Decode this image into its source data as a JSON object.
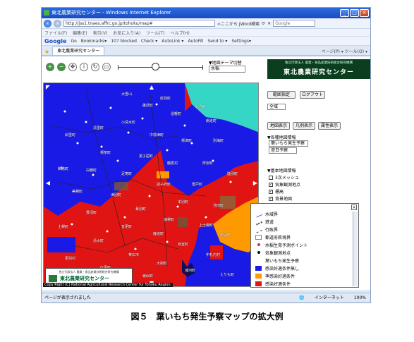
{
  "browser": {
    "title": "東北農業研究センター - Windows Internet Explorer",
    "address": "http://jss1.tnaes.affrc.go.jp/tohoku/map#",
    "address_hint": "<ここから JWord検索",
    "search_placeholder": "Google",
    "menu": [
      "ファイル(F)",
      "編集(E)",
      "表示(V)",
      "お気に入り(A)",
      "ツール(T)",
      "ヘルプ(H)"
    ],
    "toolbar": [
      "Go",
      "Bookmarks▾",
      "107 blocked",
      "Check ▾",
      "AutoLink ▾",
      "AutoFill",
      "Send to ▾",
      "Settings▾"
    ],
    "tab_title": "東北農業研究センター",
    "tab_tools": "ページ(P) ▾  ツール(O) ▾",
    "status_left": "ページが表示されました",
    "status_zone": "インターネット",
    "status_zoom": "100%"
  },
  "map": {
    "theme_label": "▼地図テーマ切替",
    "theme_value": "水稲",
    "copyright": "Copy Right (C) National Agricultural Research Center for Tohoku Region.",
    "logo_org": "独立行政法人 農業・食品産業技術総合研究機構",
    "logo_name": "東北農業研究センター"
  },
  "side": {
    "brand_sub": "独立行政法人 農業・食品産業技術総合研究機構",
    "brand_name": "東北農業研究センター",
    "btn_range": "範囲指定",
    "btn_logout": "ログアウト",
    "select_all": "全域",
    "btn_mapshow": "地図表示",
    "btn_legend": "凡例表示",
    "btn_attr": "属性表示",
    "info_title": "▼各種地図情報",
    "info_select": "葉いもち発生予察",
    "date_select": "翌日予察",
    "base_title": "▼基本地図情報",
    "checks": [
      {
        "label": "3次メッシュ",
        "checked": false
      },
      {
        "label": "気象観測地点",
        "checked": true
      },
      {
        "label": "標高",
        "checked": true
      },
      {
        "label": "背景地図",
        "checked": true
      }
    ]
  },
  "legend": {
    "items": [
      {
        "label": "水域界",
        "symbol": "line-blue",
        "color": "#4a6fd0"
      },
      {
        "label": "鉄道",
        "symbol": "rail",
        "color": "#444444"
      },
      {
        "label": "行政界",
        "symbol": "line-dashed",
        "color": "#444444"
      },
      {
        "label": "都道府県境界",
        "symbol": "box-empty",
        "color": "#888888"
      },
      {
        "label": "水稲生育予測ポイント",
        "symbol": "dot",
        "color": "#cc3333"
      },
      {
        "label": "気象観測地点",
        "symbol": "dot",
        "color": "#111111"
      },
      {
        "label": "葉いもち発生予察",
        "symbol": "none",
        "color": "#ffffff"
      },
      {
        "label": "感染好適条件無し",
        "symbol": "fill",
        "color": "#1a1ae6"
      },
      {
        "label": "準感染好適条件",
        "symbol": "fill",
        "color": "#ff9900"
      },
      {
        "label": "感染好適条件",
        "symbol": "fill",
        "color": "#e11414"
      }
    ]
  },
  "place_labels": [
    "大雪山",
    "雄武町",
    "紋別町",
    "遠軽町",
    "北見町",
    "網走町",
    "小清水町",
    "清里町",
    "斜里町",
    "中標津町",
    "標津町",
    "別海町",
    "標茶町",
    "弟子屈町",
    "鶴居村",
    "厚岸町",
    "釧路町",
    "白糠町",
    "足寄町",
    "陸別町",
    "訓子府町",
    "置戸町",
    "美幌町",
    "津別町",
    "本別町",
    "池田町",
    "幕別町",
    "豊頃町",
    "浦幌町",
    "上士幌町",
    "士幌町",
    "音更町",
    "鹿追町",
    "新得町",
    "清水町",
    "芽室町",
    "帯広市",
    "中札内村",
    "更別村",
    "大樹町",
    "広尾町",
    "浦河町",
    "様似町",
    "えりも町"
  ],
  "caption": "図５　葉いもち発生予察マップの拡大例"
}
